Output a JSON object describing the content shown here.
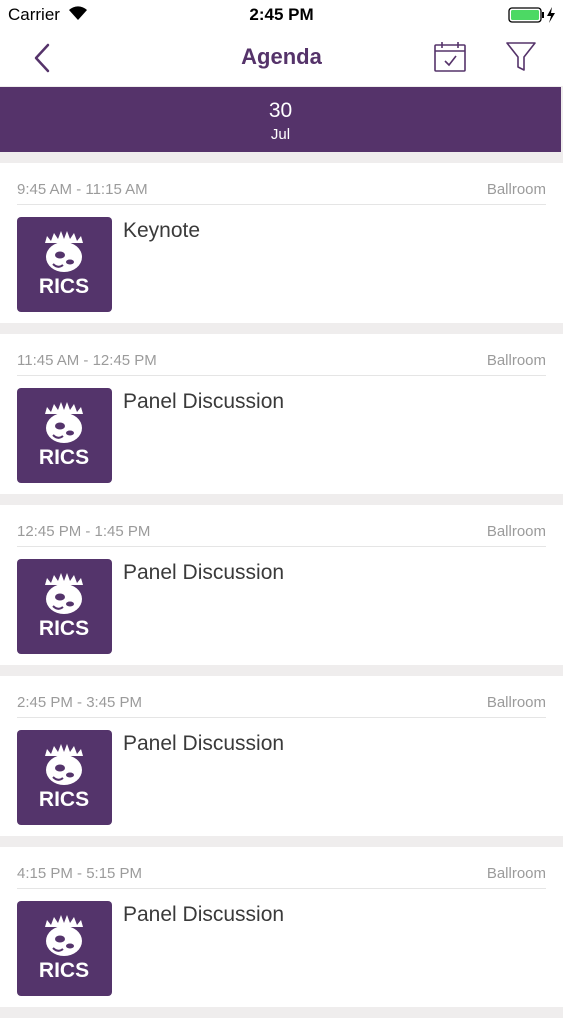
{
  "status_bar": {
    "carrier": "Carrier",
    "time": "2:45 PM"
  },
  "nav": {
    "title": "Agenda"
  },
  "date": {
    "day": "30",
    "month": "Jul"
  },
  "brand_color": "#55336a",
  "logo_text": "RICS",
  "sessions": [
    {
      "time": "9:45 AM - 11:15 AM",
      "room": "Ballroom",
      "title": "Keynote"
    },
    {
      "time": "11:45 AM - 12:45 PM",
      "room": "Ballroom",
      "title": "Panel Discussion"
    },
    {
      "time": "12:45 PM - 1:45 PM",
      "room": "Ballroom",
      "title": "Panel Discussion"
    },
    {
      "time": "2:45 PM - 3:45 PM",
      "room": "Ballroom",
      "title": "Panel Discussion"
    },
    {
      "time": "4:15 PM - 5:15 PM",
      "room": "Ballroom",
      "title": "Panel Discussion"
    }
  ]
}
